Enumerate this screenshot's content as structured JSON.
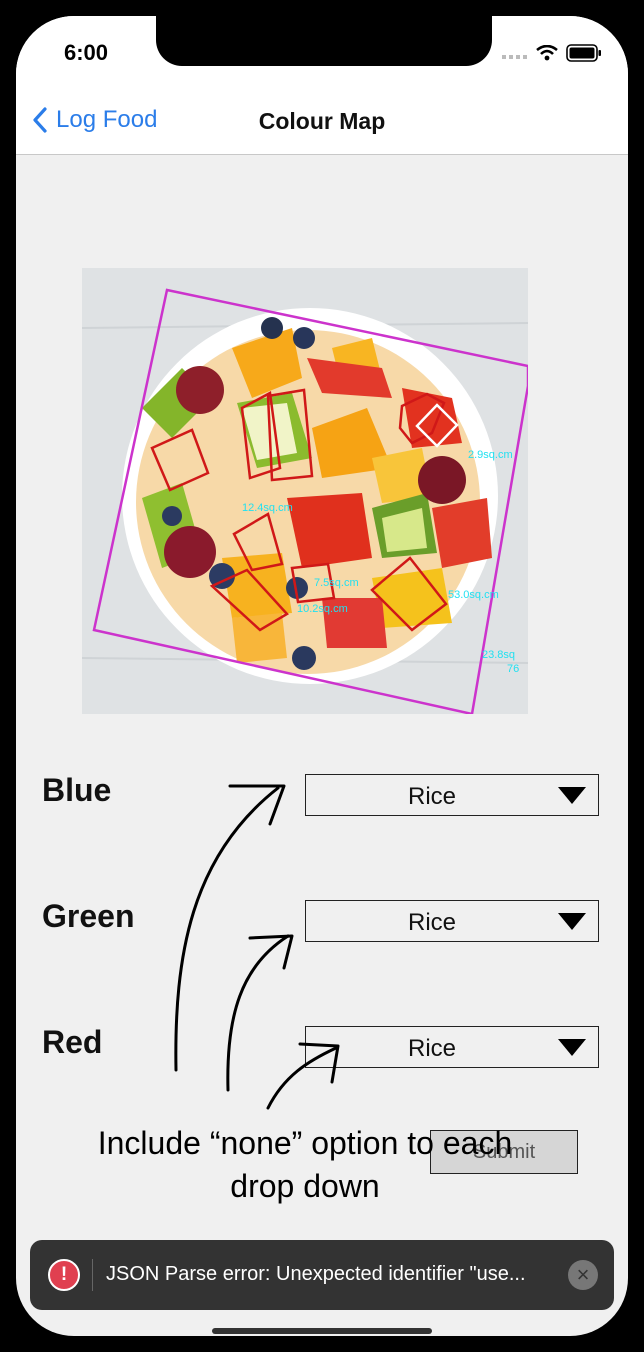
{
  "status": {
    "time": "6:00"
  },
  "nav": {
    "back_label": "Log Food",
    "title": "Colour Map"
  },
  "photo": {
    "areas": [
      "2.9sq.cm",
      "12.4sq.cm",
      "7.5sq.cm",
      "10.2sq.cm",
      "53.0sq.cm",
      "23.8sq",
      "76"
    ]
  },
  "rows": [
    {
      "label": "Blue",
      "value": "Rice"
    },
    {
      "label": "Green",
      "value": "Rice"
    },
    {
      "label": "Red",
      "value": "Rice"
    }
  ],
  "submit_label": "Submit",
  "annotation": [
    "Include “none” option to each",
    "drop down"
  ],
  "toast": {
    "message": "JSON Parse error: Unexpected identifier \"use..."
  },
  "colors": {
    "accent": "#2b7de9",
    "box": "#d01818",
    "outer_box": "#cc33cc",
    "area_text": "#22e0f0"
  }
}
